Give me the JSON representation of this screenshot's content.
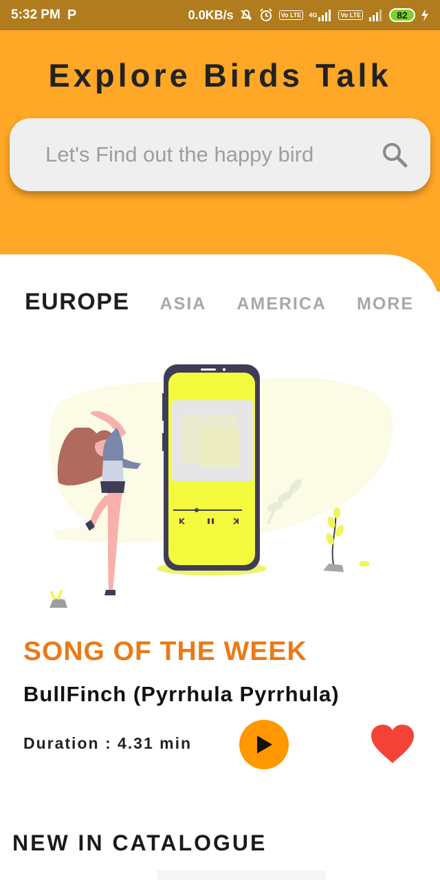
{
  "status_bar": {
    "time": "5:32 PM",
    "app_indicator": "P",
    "network_speed": "0.0KB/s",
    "network_type": "4G",
    "lte_label": "Vo LTE",
    "battery_level": "82",
    "icons": [
      "mute-icon",
      "alarm-icon",
      "signal-icon",
      "charging-icon"
    ]
  },
  "header": {
    "title": "Explore Birds Talk",
    "background_color": "#ffa726"
  },
  "search": {
    "placeholder": "Let's Find out the happy bird",
    "icon": "search-icon"
  },
  "tabs": [
    {
      "label": "EUROPE",
      "active": true
    },
    {
      "label": "ASIA",
      "active": false
    },
    {
      "label": "AMERICA",
      "active": false
    },
    {
      "label": "MORE",
      "active": false
    }
  ],
  "illustration": {
    "icon": "music-player-illustration"
  },
  "song_of_week": {
    "heading": "SONG OF THE WEEK",
    "bird_name": "BullFinch (Pyrrhula Pyrrhula)",
    "duration": "Duration : 4.31 min",
    "accent_color": "#ea7a16",
    "play_icon": "play-icon",
    "favorite_icon": "heart-icon",
    "favorite_color": "#f44336"
  },
  "catalogue": {
    "heading": "NEW IN CATALOGUE"
  }
}
